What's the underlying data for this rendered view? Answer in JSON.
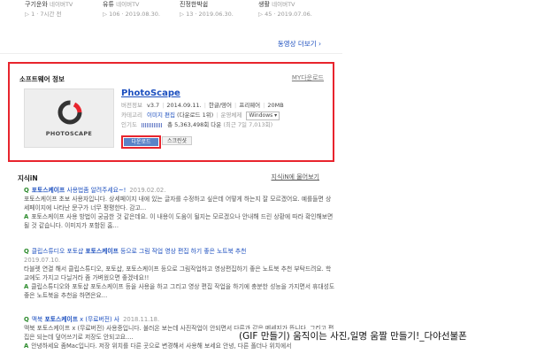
{
  "videos": [
    {
      "title": "구기운와",
      "meta": "▷ 1 · 7시간 전",
      "source": "네이버TV"
    },
    {
      "title": "유튜",
      "meta": "▷ 106 · 2019.08.30.",
      "source": "네이버TV"
    },
    {
      "title": "진정한박쉽",
      "meta": "▷ 13 · 2019.06.30.",
      "source": "네이버TV"
    },
    {
      "title": "생활",
      "meta": "▷ 45 · 2019.07.06.",
      "source": "네이버TV"
    }
  ],
  "more_video": "동영상 더보기",
  "software": {
    "section_title": "소프트웨어 정보",
    "my_download": "MY다운로드",
    "name": "PhotoScape",
    "logo_text": "PHOTOSCAPE",
    "version_label": "버전정보",
    "version": "v3.7",
    "release_date": "2014.09.11.",
    "language": "한글/영어",
    "license": "프리웨어",
    "size": "20MB",
    "category_label": "카테고리",
    "category": "이미지 편집",
    "category_rank": "(다운로드 1위)",
    "os_label": "운영체제",
    "os": "Windows",
    "popularity_label": "인기도",
    "downloads": "총 5,363,498회 다운",
    "recent_downloads": "(최근 7일 7,013회)",
    "download_button": "다운로드",
    "screenshot_button": "스크린샷"
  },
  "kin": {
    "title": "지식iN",
    "more": "지식iN에 물어보기",
    "items": [
      {
        "question_pre": "",
        "question_bold": "포토스케이프",
        "question_post": " 사용법좀 알려주세요~!",
        "date": "2019.02.02.",
        "body": "포토스케이프 초보 사용자입니다. 상세페이지 내에 있는 글자를 수정하고 싶은데 어떻게 하는지 잘 모르겠어요. 예를들면 상세페이지에 나타난 문구가 너무 평평한다. 감고...",
        "answer": "포토스케이프 사용 방법이 궁금한 것 같은데요. 이 내용이 도움이 될지는 모르겠으나 안내해 드린 상황에 따라 확인해보면 될 것 같습니다. 이미지가 포함된 홈..."
      },
      {
        "question_pre": "클립스튜디오 포토샵 ",
        "question_bold": "포토스케이프",
        "question_post": " 등으로 그림 작업 영상 편집 하기 좋은 노트북 추천",
        "date": "2019.07.10.",
        "body": "타블렛 연결 해서 클립스튜디오, 포토샵, 포토스케이프 등으로 그림작업하고 영상편집하기 좋은 노트북 추천 부탁드려요. 학교에도 가지고 다닐거라 좀 가벼웠으면 좋겠네요!!",
        "answer": "클립스튜디오와 포토샵 포토스케이프 등을 사용을 하고 그리고 영상 편집 작업을 하기에 충분한 성능을 가지면서 휴대성도 좋은 노트북을 추천을 하면은요..."
      },
      {
        "question_pre": "맥북 ",
        "question_bold": "포토스케이프",
        "question_post": " x (무료버전) 사",
        "date": "2018.11.18.",
        "body": "맥북 포토스케이프 x (무료버전) 사용중입니다. 불러온 보는데 사진작업이 안되면서 다른과 같은 메세지가 뜹니다. 그리고 편집은 되는데 덮어쓰기로 저장도 안되고요....",
        "answer": "안녕하세요 좀Mac입니다. 저장 위치를 다른 곳으로 변경해서 사용해 보세요 안녕, 다른 폴더나 위치에서"
      }
    ]
  },
  "caption": "(GIF 만들기) 움직이는 사진,일명 움짤 만들기!_다야선불폰",
  "colors": {
    "highlight": "#e8242d",
    "link": "#1c4fbf",
    "answer_mark": "#2a8a2a"
  }
}
